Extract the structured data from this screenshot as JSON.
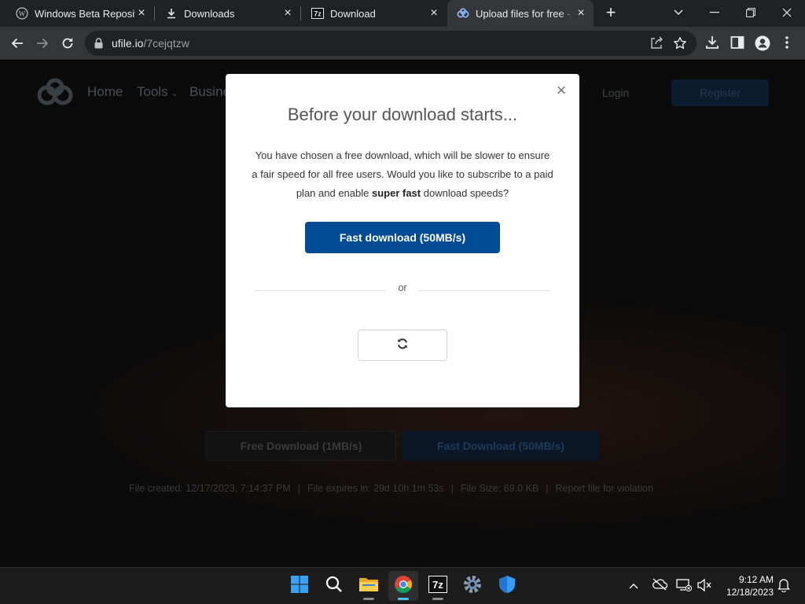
{
  "browser": {
    "tabs": [
      {
        "title": "Windows Beta Reposito",
        "favicon": "wordpress-icon"
      },
      {
        "title": "Downloads",
        "favicon": "download-icon"
      },
      {
        "title": "Download",
        "favicon": "7zip-icon"
      },
      {
        "title": "Upload files for free - g",
        "favicon": "ufile-icon",
        "active": true
      }
    ],
    "url_host": "ufile.io",
    "url_path": "/7cejqtzw"
  },
  "site": {
    "nav": [
      "Home",
      "Tools",
      "Busine"
    ],
    "login": "Login",
    "register": "Register",
    "free_download": "Free Download (1MB/s)",
    "fast_download": "Fast Download (50MB/s)",
    "meta": {
      "created": "File created: 12/17/2023, 7:14:37 PM",
      "expires": "File expires in: 29d 10h 1m 53s",
      "size": "File Size: 69.0 KB",
      "report": "Report file for violation",
      "sep": "|"
    }
  },
  "modal": {
    "title": "Before your download starts...",
    "body_line1": "You have chosen a free download, which will be slower to ensure",
    "body_line2": "a fair speed for all free users. Would you like to subscribe to a paid",
    "body_line3_pre": "plan and enable ",
    "body_line3_bold": "super fast",
    "body_line3_post": " download speeds?",
    "fast_button": "Fast download (50MB/s)",
    "or": "or",
    "close": "×"
  },
  "taskbar": {
    "time": "9:12 AM",
    "date": "12/18/2023",
    "apps": [
      "windows-start-icon",
      "search-icon",
      "file-explorer-icon",
      "chrome-icon",
      "7zip-icon",
      "settings-icon",
      "defender-icon"
    ]
  },
  "colors": {
    "modal_button": "#004b93",
    "chrome_dark": "#202124",
    "chrome_toolbar": "#35363a"
  }
}
